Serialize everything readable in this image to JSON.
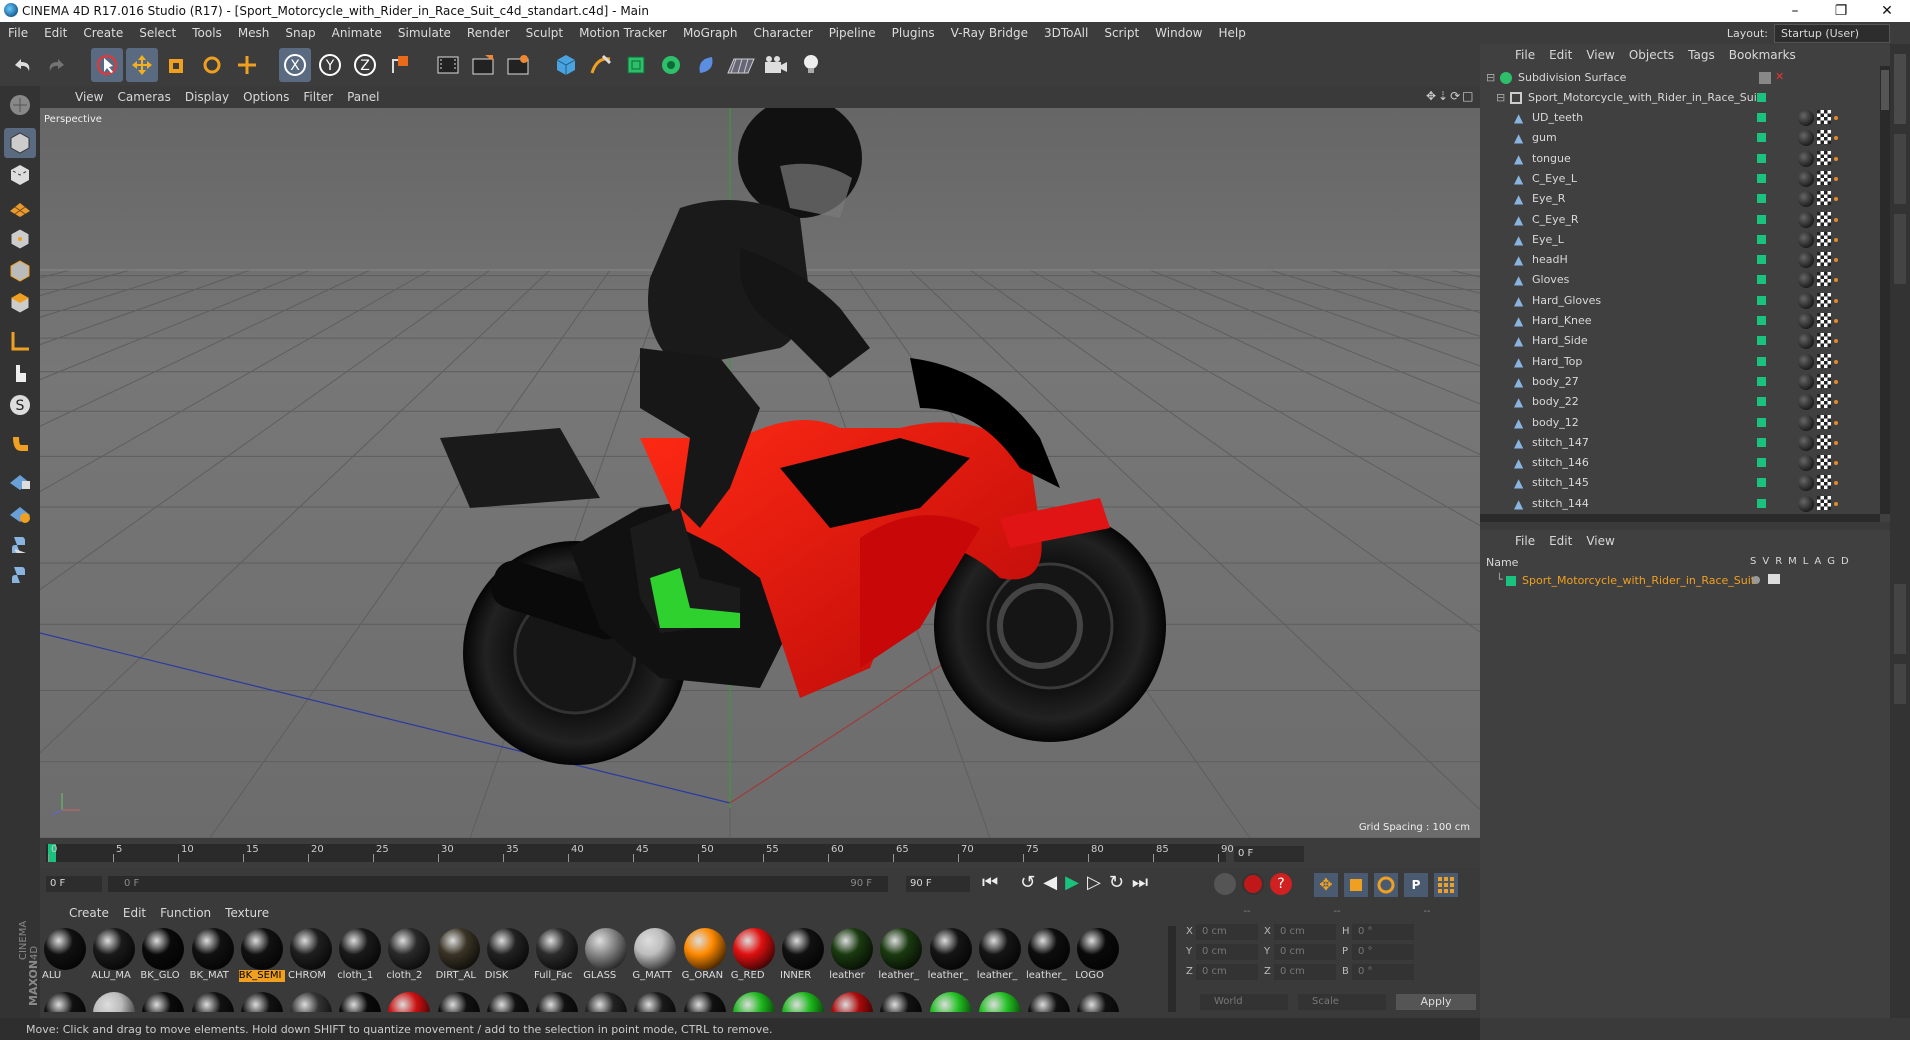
{
  "window": {
    "title": "CINEMA 4D R17.016 Studio (R17) - [Sport_Motorcycle_with_Rider_in_Race_Suit_c4d_standart.c4d] - Main",
    "minimize": "–",
    "restore": "❐",
    "close": "✕"
  },
  "menubar": [
    "File",
    "Edit",
    "Create",
    "Select",
    "Tools",
    "Mesh",
    "Snap",
    "Animate",
    "Simulate",
    "Render",
    "Sculpt",
    "Motion Tracker",
    "MoGraph",
    "Character",
    "Pipeline",
    "Plugins",
    "V-Ray Bridge",
    "3DToAll",
    "Script",
    "Window",
    "Help"
  ],
  "layout": {
    "label": "Layout:",
    "value": "Startup (User)"
  },
  "toolbar": {
    "axis_x": "X",
    "axis_y": "Y",
    "axis_z": "Z",
    "icons": [
      "undo-icon",
      "redo-icon",
      "select-arrow-icon",
      "move-icon",
      "scale-icon",
      "rotate-icon",
      "last-tool-icon",
      "x-lock-icon",
      "y-lock-icon",
      "z-lock-icon",
      "coordinate-system-icon",
      "render-view-icon",
      "render-picture-viewer-icon",
      "edit-render-settings-icon",
      "cube-icon",
      "pen-spline-icon",
      "subdivision-icon",
      "array-icon",
      "deformer-icon",
      "floor-icon",
      "camera-icon",
      "light-icon"
    ]
  },
  "viewport": {
    "menu": [
      "View",
      "Cameras",
      "Display",
      "Options",
      "Filter",
      "Panel"
    ],
    "label": "Perspective",
    "grid_spacing": "Grid Spacing : 100 cm"
  },
  "timeline": {
    "ticks": [
      "0",
      "5",
      "10",
      "15",
      "20",
      "25",
      "30",
      "35",
      "40",
      "45",
      "50",
      "55",
      "60",
      "65",
      "70",
      "75",
      "80",
      "85",
      "90"
    ],
    "current_frame": "0 F",
    "start": "0 F",
    "range_start": "0 F",
    "range_end": "90 F",
    "end": "90 F"
  },
  "materials": {
    "menu": [
      "Create",
      "Edit",
      "Function",
      "Texture"
    ],
    "row1": [
      {
        "label": "ALU",
        "color": "#111111",
        "highlight": false
      },
      {
        "label": "ALU_MA",
        "color": "#1a1a1a",
        "highlight": false
      },
      {
        "label": "BK_GLO",
        "color": "#0a0a0a",
        "highlight": false
      },
      {
        "label": "BK_MAT",
        "color": "#111111",
        "highlight": false
      },
      {
        "label": "BK_SEMI",
        "color": "#111111",
        "highlight": true
      },
      {
        "label": "CHROM",
        "color": "#1f1f1f",
        "highlight": false
      },
      {
        "label": "cloth_1",
        "color": "#1a1a1a",
        "highlight": false
      },
      {
        "label": "cloth_2",
        "color": "#2a2a2a",
        "highlight": false
      },
      {
        "label": "DIRT_AL",
        "color": "#3a3426",
        "highlight": false
      },
      {
        "label": "DISK",
        "color": "#222222",
        "highlight": false
      },
      {
        "label": "Full_Fac",
        "color": "#2c2c2c",
        "highlight": false
      },
      {
        "label": "GLASS",
        "color": "#8a8a8a",
        "highlight": false
      },
      {
        "label": "G_MATT",
        "color": "#bdbdbd",
        "highlight": false
      },
      {
        "label": "G_ORAN",
        "color": "#ff8a00",
        "highlight": false
      },
      {
        "label": "G_RED",
        "color": "#e01010",
        "highlight": false
      },
      {
        "label": "INNER",
        "color": "#111111",
        "highlight": false
      },
      {
        "label": "leather",
        "color": "#1a3a10",
        "highlight": false
      },
      {
        "label": "leather_",
        "color": "#1a3a10",
        "highlight": false
      },
      {
        "label": "leather_",
        "color": "#151515",
        "highlight": false
      },
      {
        "label": "leather_",
        "color": "#151515",
        "highlight": false
      },
      {
        "label": "leather_",
        "color": "#0e0e0e",
        "highlight": false
      },
      {
        "label": "LOGO",
        "color": "#0a0a0a",
        "highlight": false
      }
    ],
    "row2_colors": [
      "#111111",
      "#bbbbbb",
      "#0a0a0a",
      "#111111",
      "#111111",
      "#333333",
      "#0a0a0a",
      "#cc1010",
      "#111111",
      "#111111",
      "#111111",
      "#222222",
      "#1a1a1a",
      "#111111",
      "#1cb81c",
      "#1cb81c",
      "#aa0a0a",
      "#111111",
      "#22c022",
      "#22c022",
      "#111111",
      "#111111"
    ]
  },
  "coords": {
    "header": [
      "--",
      "--",
      "--"
    ],
    "rows": [
      {
        "a": "X",
        "av": "0 cm",
        "b": "X",
        "bv": "0 cm",
        "c": "H",
        "cv": "0 °"
      },
      {
        "a": "Y",
        "av": "0 cm",
        "b": "Y",
        "bv": "0 cm",
        "c": "P",
        "cv": "0 °"
      },
      {
        "a": "Z",
        "av": "0 cm",
        "b": "Z",
        "bv": "0 cm",
        "c": "B",
        "cv": "0 °"
      }
    ],
    "mode": "World",
    "transform": "Scale",
    "apply": "Apply"
  },
  "object_manager": {
    "menu": [
      "File",
      "Edit",
      "View",
      "Objects",
      "Tags",
      "Bookmarks"
    ],
    "root": "Subdivision Surface",
    "group": "Sport_Motorcycle_with_Rider_in_Race_Suit",
    "items": [
      "UD_teeth",
      "gum",
      "tongue",
      "C_Eye_L",
      "Eye_R",
      "C_Eye_R",
      "Eye_L",
      "headH",
      "Gloves",
      "Hard_Gloves",
      "Hard_Knee",
      "Hard_Side",
      "Hard_Top",
      "body_27",
      "body_22",
      "body_12",
      "stitch_147",
      "stitch_146",
      "stitch_145",
      "stitch_144"
    ]
  },
  "attributes": {
    "menu": [
      "File",
      "Edit",
      "View"
    ],
    "name_header": "Name",
    "flag_headers": [
      "S",
      "V",
      "R",
      "M",
      "L",
      "A",
      "G",
      "D"
    ],
    "row": "Sport_Motorcycle_with_Rider_in_Race_Suit"
  },
  "status": "Move: Click and drag to move elements. Hold down SHIFT to quantize movement / add to the selection in point mode, CTRL to remove.",
  "brand": {
    "maxon": "MAXON",
    "c4d": "CINEMA 4D"
  },
  "colors": {
    "accent_green": "#19c37d",
    "highlight_orange": "#f0a020",
    "selection_blue": "#5a6a80"
  }
}
